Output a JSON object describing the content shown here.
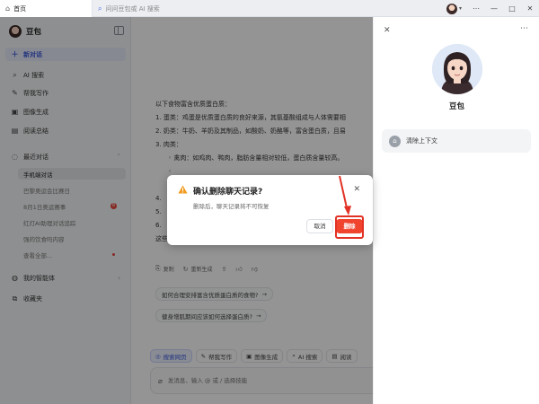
{
  "browser": {
    "tab_home": "首页",
    "address_placeholder": "问问豆包或 AI 搜索",
    "controls": [
      "⋯",
      "—",
      "□",
      "✕"
    ]
  },
  "sidebar": {
    "title": "豆包",
    "items": [
      {
        "label": "新对话",
        "icon": "plus-icon"
      },
      {
        "label": "AI 搜索",
        "icon": "search-icon"
      },
      {
        "label": "帮我写作",
        "icon": "pen-icon"
      },
      {
        "label": "图像生成",
        "icon": "image-icon"
      },
      {
        "label": "阅读总结",
        "icon": "book-icon"
      }
    ],
    "recent_header": "最近对话",
    "recent": [
      {
        "label": "手机端对话"
      },
      {
        "label": "巴黎奥运会比赛日"
      },
      {
        "label": "8月1日奥运赛事",
        "badge": "8"
      },
      {
        "label": "红灯AI助理对话追踪"
      },
      {
        "label": "强的饮食吗内容"
      },
      {
        "label": "查看全部..."
      }
    ],
    "agents_label": "我的智能体",
    "favorites_label": "收藏夹"
  },
  "chat": {
    "lines": [
      {
        "text": "以下食物富含优质蛋白质：",
        "indent": 1
      },
      {
        "text": "1. 蛋类：鸡蛋是优质蛋白质的良好来源，其氨基酸组成与人体需要相",
        "indent": 1
      },
      {
        "text": "2. 奶类：牛奶、羊奶及其制品，如酸奶、奶酪等，富含蛋白质，且易",
        "indent": 1
      },
      {
        "text": "3. 肉类：",
        "indent": 1
      },
      {
        "text": "◦ 禽肉：如鸡肉、鸭肉，脂肪含量相对较低，蛋白质含量较高。",
        "indent": 2
      },
      {
        "text": "◦",
        "indent": 2
      },
      {
        "text": "",
        "indent": 1
      },
      {
        "text": "4.",
        "indent": 1
      },
      {
        "text": "5.",
        "indent": 1
      },
      {
        "text": "6.",
        "indent": 1
      },
      {
        "text": "这些食物可以根据个人的饮食偏好和身体状况进行合理搭配和选择。",
        "indent": 1
      }
    ],
    "actions": [
      {
        "label": "复制",
        "icon": "copy-icon"
      },
      {
        "label": "重新生成",
        "icon": "refresh-icon"
      },
      {
        "label": "",
        "icon": "share-icon"
      },
      {
        "label": "",
        "icon": "thumbs-up-icon"
      },
      {
        "label": "",
        "icon": "thumbs-down-icon"
      }
    ],
    "suggestions": [
      "如何合理安排富含优质蛋白质的食物?",
      "健身增肌期间应该如何选择蛋白质?"
    ],
    "chips": [
      "搜索网页",
      "帮我写作",
      "图像生成",
      "AI 搜索",
      "阅读"
    ],
    "input_placeholder": "发消息、输入 @ 或 / 选择技能"
  },
  "profile": {
    "name": "豆包",
    "clear_label": "清除上下文"
  },
  "dialog": {
    "title": "确认删除聊天记录?",
    "body": "删除后，聊天记录将不可恢复",
    "cancel": "取消",
    "delete": "删除"
  },
  "colors": {
    "accent": "#3b5bdb",
    "danger": "#f0442e",
    "warning": "#f29a1f",
    "annotation": "#e23226"
  }
}
